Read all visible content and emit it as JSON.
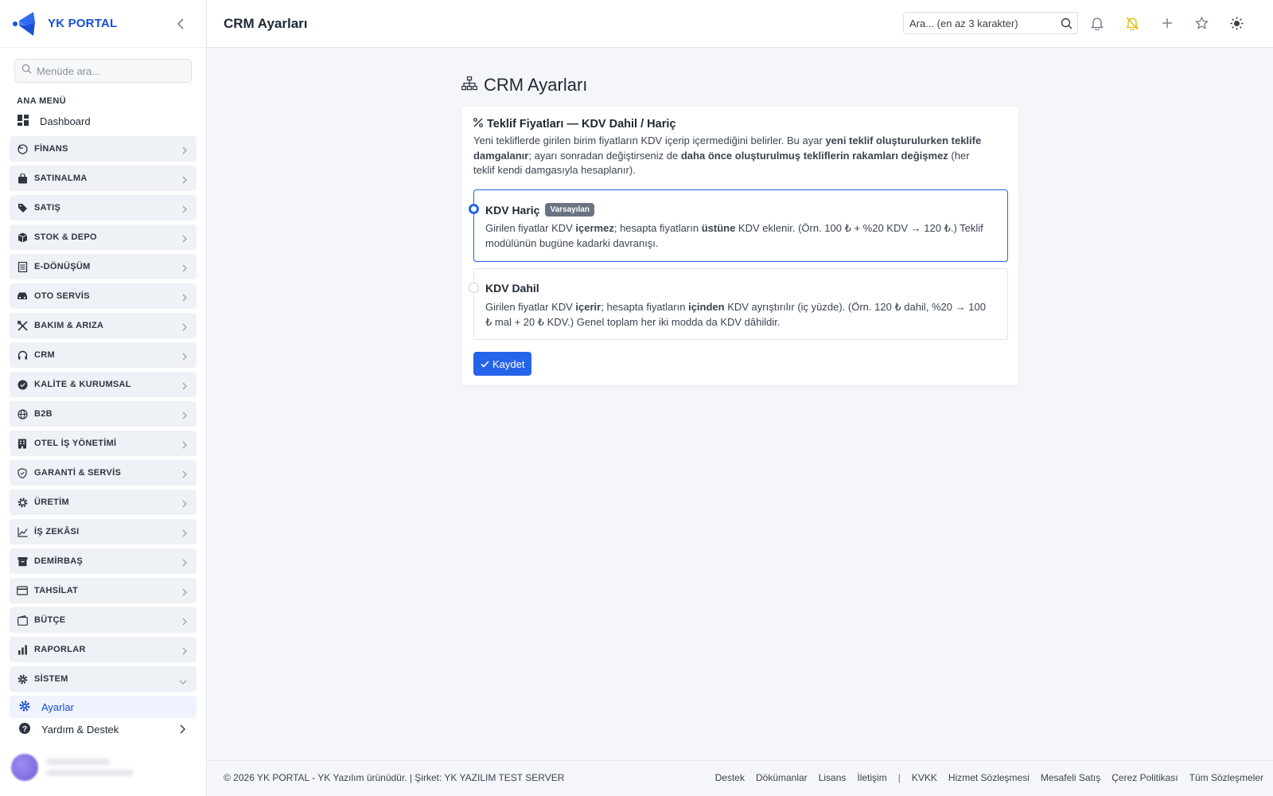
{
  "sidebar": {
    "brand": "YK PORTAL",
    "search_placeholder": "Menüde ara...",
    "section_title": "ANA MENÜ",
    "dashboard": "Dashboard",
    "menu": [
      {
        "label": "FİNANS",
        "icon": "receipt-icon"
      },
      {
        "label": "SATINALMA",
        "icon": "shopping-bag-icon"
      },
      {
        "label": "SATIŞ",
        "icon": "tag-icon"
      },
      {
        "label": "STOK & DEPO",
        "icon": "box-icon"
      },
      {
        "label": "E-DÖNÜŞÜM",
        "icon": "document-icon"
      },
      {
        "label": "OTO SERVİS",
        "icon": "car-icon"
      },
      {
        "label": "BAKIM & ARIZA",
        "icon": "tools-icon"
      },
      {
        "label": "CRM",
        "icon": "headset-icon"
      },
      {
        "label": "KALİTE & KURUMSAL",
        "icon": "badge-check-icon"
      },
      {
        "label": "B2B",
        "icon": "globe-icon"
      },
      {
        "label": "OTEL İŞ YÖNETİMİ",
        "icon": "building-icon"
      },
      {
        "label": "GARANTİ & SERVİS",
        "icon": "shield-icon"
      },
      {
        "label": "ÜRETİM",
        "icon": "cog-icon"
      },
      {
        "label": "İŞ ZEKÂSI",
        "icon": "chart-line-icon"
      },
      {
        "label": "DEMİRBAŞ",
        "icon": "archive-icon"
      },
      {
        "label": "TAHSİLAT",
        "icon": "credit-card-icon"
      },
      {
        "label": "BÜTÇE",
        "icon": "wallet-icon"
      },
      {
        "label": "RAPORLAR",
        "icon": "bar-chart-icon"
      },
      {
        "label": "SİSTEM",
        "icon": "gear-icon"
      }
    ],
    "sub_settings": "Ayarlar",
    "sub_help": "Yardım & Destek"
  },
  "topbar": {
    "title": "CRM Ayarları",
    "search_placeholder": "Ara... (en az 3 karakter)"
  },
  "main": {
    "heading": "CRM Ayarları",
    "card_title": "Teklif Fiyatları — KDV Dahil / Hariç",
    "desc": {
      "p1": "Yeni tekliflerde girilen birim fiyatların KDV içerip içermediğini belirler. Bu ayar ",
      "b1": "yeni teklif oluşturulurken teklife damgalanır",
      "p2": "; ayarı sonradan değiştirseniz de ",
      "b2": "daha önce oluşturulmuş tekliflerin rakamları değişmez",
      "p3": " (her teklif kendi damgasıyla hesaplanır)."
    },
    "option_exclusive": {
      "label": "KDV Hariç",
      "badge": "Varsayılan",
      "p1": "Girilen fiyatlar KDV ",
      "b1": "içermez",
      "p2": "; hesapta fiyatların ",
      "b2": "üstüne",
      "p3": " KDV eklenir. (Örn. 100 ₺ + %20 KDV → 120 ₺.) Teklif modülünün bugüne kadarki davranışı.",
      "selected": true
    },
    "option_inclusive": {
      "label": "KDV Dahil",
      "p1": "Girilen fiyatlar KDV ",
      "b1": "içerir",
      "p2": "; hesapta fiyatların ",
      "b2": "içinden",
      "p3": " KDV ayrıştırılır (iç yüzde). (Örn. 120 ₺ dahil, %20 → 100 ₺ mal + 20 ₺ KDV.) Genel toplam her iki modda da KDV dâhildir.",
      "selected": false
    },
    "save_label": "Kaydet"
  },
  "footer": {
    "copyright": "© 2026 YK PORTAL - YK Yazılım ürünüdür. | Şirket: YK YAZILIM TEST SERVER",
    "links": [
      "Destek",
      "Dökümanlar",
      "Lisans",
      "İletişim",
      "|",
      "KVKK",
      "Hizmet Sözleşmesi",
      "Mesafeli Satış",
      "Çerez Politikası",
      "Tüm Sözleşmeler"
    ]
  },
  "colors": {
    "accent": "#2563eb",
    "brand": "#1a4fd6",
    "warning_icon": "#e6b800"
  }
}
